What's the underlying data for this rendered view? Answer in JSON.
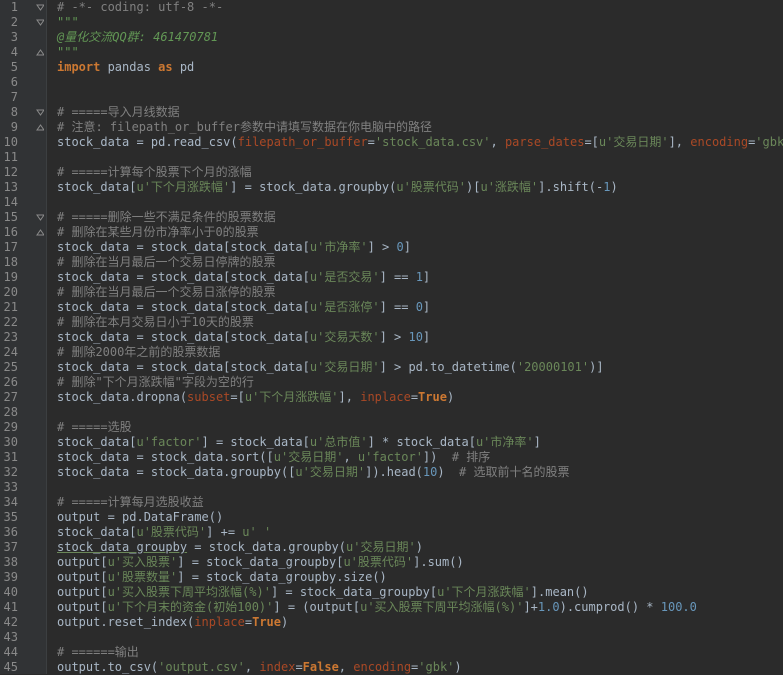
{
  "colors": {
    "background": "#2b2b2b",
    "gutter": "#313335",
    "line_number": "#8a8a8a",
    "comment": "#808080",
    "keyword": "#cc7832",
    "string": "#6a8759",
    "number": "#6897bb",
    "param": "#aa4926",
    "text": "#a9b7c6"
  },
  "lines": [
    {
      "n": "1",
      "fold": "open",
      "tokens": [
        {
          "t": "# -*- coding: utf-8 -*-",
          "c": "comment"
        }
      ]
    },
    {
      "n": "2",
      "fold": "open",
      "tokens": [
        {
          "t": "\"\"\"",
          "c": "doc"
        }
      ]
    },
    {
      "n": "3",
      "fold": "",
      "tokens": [
        {
          "t": "@量化交流QQ群: 461470781",
          "c": "docital"
        }
      ]
    },
    {
      "n": "4",
      "fold": "close",
      "tokens": [
        {
          "t": "\"\"\"",
          "c": "doc"
        }
      ]
    },
    {
      "n": "5",
      "fold": "",
      "tokens": [
        {
          "t": "import",
          "c": "kw"
        },
        {
          "t": " pandas ",
          "c": "id"
        },
        {
          "t": "as",
          "c": "kw"
        },
        {
          "t": " pd",
          "c": "id"
        }
      ]
    },
    {
      "n": "6",
      "fold": "",
      "tokens": []
    },
    {
      "n": "7",
      "fold": "",
      "tokens": []
    },
    {
      "n": "8",
      "fold": "open",
      "tokens": [
        {
          "t": "# =====导入月线数据",
          "c": "comment"
        }
      ]
    },
    {
      "n": "9",
      "fold": "close",
      "tokens": [
        {
          "t": "# 注意: filepath_or_buffer参数中请填写数据在你电脑中的路径",
          "c": "comment"
        }
      ]
    },
    {
      "n": "10",
      "fold": "",
      "tokens": [
        {
          "t": "stock_data = pd.read_csv(",
          "c": "id"
        },
        {
          "t": "filepath_or_buffer",
          "c": "param"
        },
        {
          "t": "=",
          "c": "id"
        },
        {
          "t": "'stock_data.csv'",
          "c": "str"
        },
        {
          "t": ", ",
          "c": "id"
        },
        {
          "t": "parse_dates",
          "c": "param"
        },
        {
          "t": "=[",
          "c": "id"
        },
        {
          "t": "u'交易日期'",
          "c": "str"
        },
        {
          "t": "], ",
          "c": "id"
        },
        {
          "t": "encoding",
          "c": "param"
        },
        {
          "t": "=",
          "c": "id"
        },
        {
          "t": "'gbk'",
          "c": "str"
        },
        {
          "t": ")",
          "c": "id"
        }
      ]
    },
    {
      "n": "11",
      "fold": "",
      "tokens": []
    },
    {
      "n": "12",
      "fold": "",
      "tokens": [
        {
          "t": "# =====计算每个股票下个月的涨幅",
          "c": "comment"
        }
      ]
    },
    {
      "n": "13",
      "fold": "",
      "tokens": [
        {
          "t": "stock_data[",
          "c": "id"
        },
        {
          "t": "u'下个月涨跌幅'",
          "c": "str"
        },
        {
          "t": "] = stock_data.groupby(",
          "c": "id"
        },
        {
          "t": "u'股票代码'",
          "c": "str"
        },
        {
          "t": ")[",
          "c": "id"
        },
        {
          "t": "u'涨跌幅'",
          "c": "str"
        },
        {
          "t": "].shift(-",
          "c": "id"
        },
        {
          "t": "1",
          "c": "num"
        },
        {
          "t": ")",
          "c": "id"
        }
      ]
    },
    {
      "n": "14",
      "fold": "",
      "tokens": []
    },
    {
      "n": "15",
      "fold": "open",
      "tokens": [
        {
          "t": "# =====删除一些不满足条件的股票数据",
          "c": "comment"
        }
      ]
    },
    {
      "n": "16",
      "fold": "close",
      "tokens": [
        {
          "t": "# 删除在某些月份市净率小于0的股票",
          "c": "comment"
        }
      ]
    },
    {
      "n": "17",
      "fold": "",
      "tokens": [
        {
          "t": "stock_data = stock_data[stock_data[",
          "c": "id"
        },
        {
          "t": "u'市净率'",
          "c": "str"
        },
        {
          "t": "] > ",
          "c": "id"
        },
        {
          "t": "0",
          "c": "num"
        },
        {
          "t": "]",
          "c": "id"
        }
      ]
    },
    {
      "n": "18",
      "fold": "",
      "tokens": [
        {
          "t": "# 删除在当月最后一个交易日停牌的股票",
          "c": "comment"
        }
      ]
    },
    {
      "n": "19",
      "fold": "",
      "tokens": [
        {
          "t": "stock_data = stock_data[stock_data[",
          "c": "id"
        },
        {
          "t": "u'是否交易'",
          "c": "str"
        },
        {
          "t": "] == ",
          "c": "id"
        },
        {
          "t": "1",
          "c": "num"
        },
        {
          "t": "]",
          "c": "id"
        }
      ]
    },
    {
      "n": "20",
      "fold": "",
      "tokens": [
        {
          "t": "# 删除在当月最后一个交易日涨停的股票",
          "c": "comment"
        }
      ]
    },
    {
      "n": "21",
      "fold": "",
      "tokens": [
        {
          "t": "stock_data = stock_data[stock_data[",
          "c": "id"
        },
        {
          "t": "u'是否涨停'",
          "c": "str"
        },
        {
          "t": "] == ",
          "c": "id"
        },
        {
          "t": "0",
          "c": "num"
        },
        {
          "t": "]",
          "c": "id"
        }
      ]
    },
    {
      "n": "22",
      "fold": "",
      "tokens": [
        {
          "t": "# 删除在本月交易日小于10天的股票",
          "c": "comment"
        }
      ]
    },
    {
      "n": "23",
      "fold": "",
      "tokens": [
        {
          "t": "stock_data = stock_data[stock_data[",
          "c": "id"
        },
        {
          "t": "u'交易天数'",
          "c": "str"
        },
        {
          "t": "] > ",
          "c": "id"
        },
        {
          "t": "10",
          "c": "num"
        },
        {
          "t": "]",
          "c": "id"
        }
      ]
    },
    {
      "n": "24",
      "fold": "",
      "tokens": [
        {
          "t": "# 删除2000年之前的股票数据",
          "c": "comment"
        }
      ]
    },
    {
      "n": "25",
      "fold": "",
      "tokens": [
        {
          "t": "stock_data = stock_data[stock_data[",
          "c": "id"
        },
        {
          "t": "u'交易日期'",
          "c": "str"
        },
        {
          "t": "] > pd.to_datetime(",
          "c": "id"
        },
        {
          "t": "'20000101'",
          "c": "str"
        },
        {
          "t": ")]",
          "c": "id"
        }
      ]
    },
    {
      "n": "26",
      "fold": "",
      "tokens": [
        {
          "t": "# 删除\"下个月涨跌幅\"字段为空的行",
          "c": "comment"
        }
      ]
    },
    {
      "n": "27",
      "fold": "",
      "tokens": [
        {
          "t": "stock_data.dropna(",
          "c": "id"
        },
        {
          "t": "subset",
          "c": "param"
        },
        {
          "t": "=[",
          "c": "id"
        },
        {
          "t": "u'下个月涨跌幅'",
          "c": "str"
        },
        {
          "t": "], ",
          "c": "id"
        },
        {
          "t": "inplace",
          "c": "param"
        },
        {
          "t": "=",
          "c": "id"
        },
        {
          "t": "True",
          "c": "true"
        },
        {
          "t": ")",
          "c": "id"
        }
      ]
    },
    {
      "n": "28",
      "fold": "",
      "tokens": []
    },
    {
      "n": "29",
      "fold": "",
      "tokens": [
        {
          "t": "# =====选股",
          "c": "comment"
        }
      ]
    },
    {
      "n": "30",
      "fold": "",
      "tokens": [
        {
          "t": "stock_data[",
          "c": "id"
        },
        {
          "t": "u'factor'",
          "c": "str"
        },
        {
          "t": "] = stock_data[",
          "c": "id"
        },
        {
          "t": "u'总市值'",
          "c": "str"
        },
        {
          "t": "] * stock_data[",
          "c": "id"
        },
        {
          "t": "u'市净率'",
          "c": "str"
        },
        {
          "t": "]",
          "c": "id"
        }
      ]
    },
    {
      "n": "31",
      "fold": "",
      "tokens": [
        {
          "t": "stock_data = stock_data.sort([",
          "c": "id"
        },
        {
          "t": "u'交易日期'",
          "c": "str"
        },
        {
          "t": ", ",
          "c": "id"
        },
        {
          "t": "u'factor'",
          "c": "str"
        },
        {
          "t": "])  ",
          "c": "id"
        },
        {
          "t": "# 排序",
          "c": "comment"
        }
      ]
    },
    {
      "n": "32",
      "fold": "",
      "tokens": [
        {
          "t": "stock_data = stock_data.groupby([",
          "c": "id"
        },
        {
          "t": "u'交易日期'",
          "c": "str"
        },
        {
          "t": "]).head(",
          "c": "id"
        },
        {
          "t": "10",
          "c": "num"
        },
        {
          "t": ")  ",
          "c": "id"
        },
        {
          "t": "# 选取前十名的股票",
          "c": "comment"
        }
      ]
    },
    {
      "n": "33",
      "fold": "",
      "tokens": []
    },
    {
      "n": "34",
      "fold": "",
      "tokens": [
        {
          "t": "# =====计算每月选股收益",
          "c": "comment"
        }
      ]
    },
    {
      "n": "35",
      "fold": "",
      "tokens": [
        {
          "t": "output = pd.DataFrame()",
          "c": "id"
        }
      ]
    },
    {
      "n": "36",
      "fold": "",
      "tokens": [
        {
          "t": "stock_data[",
          "c": "id"
        },
        {
          "t": "u'股票代码'",
          "c": "str"
        },
        {
          "t": "] += ",
          "c": "id"
        },
        {
          "t": "u' '",
          "c": "str"
        }
      ]
    },
    {
      "n": "37",
      "fold": "",
      "tokens": [
        {
          "t": "stock_data_groupby",
          "c": "under"
        },
        {
          "t": " = stock_data.groupby(",
          "c": "id"
        },
        {
          "t": "u'交易日期'",
          "c": "str"
        },
        {
          "t": ")",
          "c": "id"
        }
      ]
    },
    {
      "n": "38",
      "fold": "",
      "tokens": [
        {
          "t": "output[",
          "c": "id"
        },
        {
          "t": "u'买入股票'",
          "c": "str"
        },
        {
          "t": "] = stock_data_groupby[",
          "c": "id"
        },
        {
          "t": "u'股票代码'",
          "c": "str"
        },
        {
          "t": "].sum()",
          "c": "id"
        }
      ]
    },
    {
      "n": "39",
      "fold": "",
      "tokens": [
        {
          "t": "output[",
          "c": "id"
        },
        {
          "t": "u'股票数量'",
          "c": "str"
        },
        {
          "t": "] = stock_data_groupby.size()",
          "c": "id"
        }
      ]
    },
    {
      "n": "40",
      "fold": "",
      "tokens": [
        {
          "t": "output[",
          "c": "id"
        },
        {
          "t": "u'买入股票下周平均涨幅(%)'",
          "c": "str"
        },
        {
          "t": "] = stock_data_groupby[",
          "c": "id"
        },
        {
          "t": "u'下个月涨跌幅'",
          "c": "str"
        },
        {
          "t": "].mean()",
          "c": "id"
        }
      ]
    },
    {
      "n": "41",
      "fold": "",
      "tokens": [
        {
          "t": "output[",
          "c": "id"
        },
        {
          "t": "u'下个月末的资金(初始100)'",
          "c": "str"
        },
        {
          "t": "] = (output[",
          "c": "id"
        },
        {
          "t": "u'买入股票下周平均涨幅(%)'",
          "c": "str"
        },
        {
          "t": "]+",
          "c": "id"
        },
        {
          "t": "1.0",
          "c": "num"
        },
        {
          "t": ").cumprod() * ",
          "c": "id"
        },
        {
          "t": "100.0",
          "c": "num"
        }
      ]
    },
    {
      "n": "42",
      "fold": "",
      "tokens": [
        {
          "t": "output.reset_index(",
          "c": "id"
        },
        {
          "t": "inplace",
          "c": "param"
        },
        {
          "t": "=",
          "c": "id"
        },
        {
          "t": "True",
          "c": "true"
        },
        {
          "t": ")",
          "c": "id"
        }
      ]
    },
    {
      "n": "43",
      "fold": "",
      "tokens": []
    },
    {
      "n": "44",
      "fold": "",
      "tokens": [
        {
          "t": "# ======输出",
          "c": "comment"
        }
      ]
    },
    {
      "n": "45",
      "fold": "",
      "tokens": [
        {
          "t": "output.to_csv(",
          "c": "id"
        },
        {
          "t": "'output.csv'",
          "c": "str"
        },
        {
          "t": ", ",
          "c": "id"
        },
        {
          "t": "index",
          "c": "param"
        },
        {
          "t": "=",
          "c": "id"
        },
        {
          "t": "False",
          "c": "true"
        },
        {
          "t": ", ",
          "c": "id"
        },
        {
          "t": "encoding",
          "c": "param"
        },
        {
          "t": "=",
          "c": "id"
        },
        {
          "t": "'gbk'",
          "c": "str"
        },
        {
          "t": ")",
          "c": "id"
        }
      ]
    }
  ]
}
